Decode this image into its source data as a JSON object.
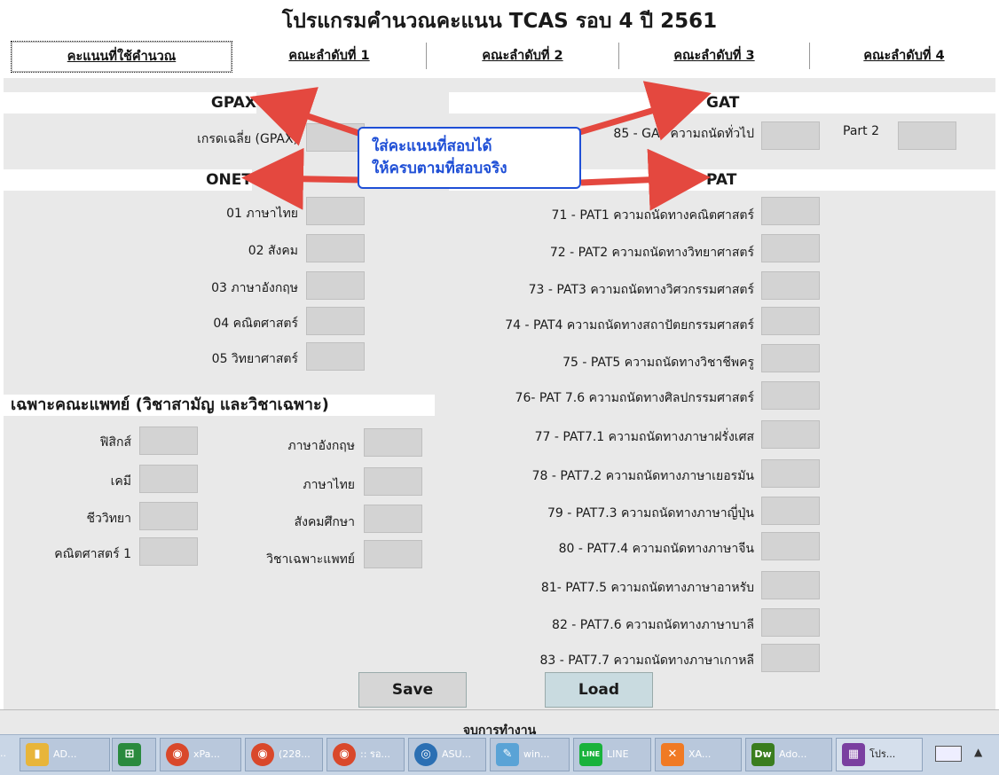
{
  "title": "โปรแกรมคำนวณคะแนน TCAS รอบ 4 ปี 2561",
  "tabs": [
    "คะแนนที่ใช้คำนวณ",
    "คณะลำดับที่ 1",
    "คณะลำดับที่ 2",
    "คณะลำดับที่ 3",
    "คณะลำดับที่ 4"
  ],
  "sections": {
    "gpax": "GPAX",
    "gat": "GAT",
    "onet": "ONET",
    "pat": "PAT",
    "medical": "เฉพาะคณะแพทย์ (วิชาสามัญ และวิชาเฉพาะ)"
  },
  "gpax_label": "เกรดเฉลี่ย (GPAX)",
  "gat_label": "85 - GAT ความถนัดทั่วไป",
  "gat_part2": "Part 2",
  "onet": [
    "01 ภาษาไทย",
    "02 สังคม",
    "03 ภาษาอังกฤษ",
    "04 คณิตศาสตร์",
    "05 วิทยาศาสตร์"
  ],
  "pat": [
    "71 - PAT1 ความถนัดทางคณิตศาสตร์",
    "72 - PAT2 ความถนัดทางวิทยาศาสตร์",
    "73 - PAT3 ความถนัดทางวิศวกรรมศาสตร์",
    "74 - PAT4 ความถนัดทางสถาปัตยกรรมศาสตร์",
    "75 - PAT5 ความถนัดทางวิชาชีพครู",
    "76- PAT 7.6 ความถนัดทางศิลปกรรมศาสตร์",
    "77 - PAT7.1 ความถนัดทางภาษาฝรั่งเศส",
    "78 - PAT7.2 ความถนัดทางภาษาเยอรมัน",
    "79 - PAT7.3 ความถนัดทางภาษาญี่ปุ่น",
    "80 - PAT7.4 ความถนัดทางภาษาจีน",
    "81-  PAT7.5 ความถนัดทางภาษาอาหรับ",
    "82 - PAT7.6 ความถนัดทางภาษาบาลี",
    "83 - PAT7.7 ความถนัดทางภาษาเกาหลี"
  ],
  "medical_left": [
    "ฟิสิกส์",
    "เคมี",
    "ชีววิทยา",
    "คณิตศาสตร์ 1"
  ],
  "medical_right": [
    "ภาษาอังกฤษ",
    "ภาษาไทย",
    "สังคมศึกษา",
    "วิชาเฉพาะแพทย์"
  ],
  "callout": [
    "ใส่คะแนนที่สอบได้",
    "ให้ครบตามที่สอบจริง"
  ],
  "buttons": {
    "save": "Save",
    "load": "Load"
  },
  "status": "จบการทำงาน",
  "taskbar": [
    {
      "label": "AD...",
      "icon": "folder-icon",
      "color": "#e8b53a"
    },
    {
      "label": "",
      "icon": "store-icon",
      "color": "#2a8a3e"
    },
    {
      "label": "xPa...",
      "icon": "chrome-icon",
      "color": "#d9482b"
    },
    {
      "label": "(228...",
      "icon": "chrome-icon",
      "color": "#d9482b"
    },
    {
      "label": ":: รอ...",
      "icon": "chrome-icon",
      "color": "#d9482b"
    },
    {
      "label": "ASU...",
      "icon": "disc-icon",
      "color": "#2b6fb3"
    },
    {
      "label": "win...",
      "icon": "notepad-icon",
      "color": "#5aa3d6"
    },
    {
      "label": "LINE",
      "icon": "line-icon",
      "color": "#19b23b"
    },
    {
      "label": "XA...",
      "icon": "xampp-icon",
      "color": "#f07a24"
    },
    {
      "label": "Ado...",
      "icon": "dreamweaver-icon",
      "color": "#3a7d1e"
    },
    {
      "label": "โปร...",
      "icon": "app-icon",
      "color": "#7a3fa0"
    }
  ],
  "colors": {
    "callout_border": "#1f4fd6",
    "arrow": "#e4483f",
    "save_bg": "#d6d6d6",
    "load_bg": "#c9dbe0"
  }
}
